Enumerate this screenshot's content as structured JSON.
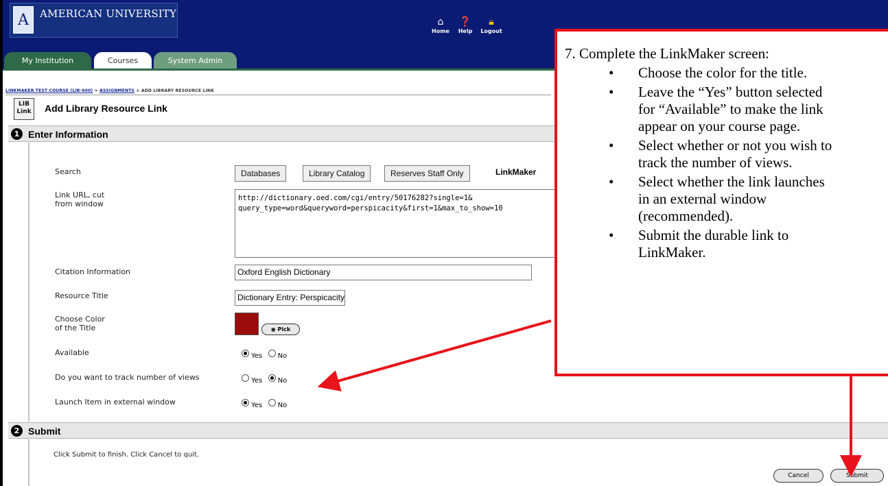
{
  "header": {
    "logo_text": "AMERICAN UNIVERSITY",
    "logo_mark": "A",
    "nav_icons": [
      {
        "label": "Home",
        "icon": "home-icon"
      },
      {
        "label": "Help",
        "icon": "help-icon"
      },
      {
        "label": "Logout",
        "icon": "lock-icon"
      }
    ]
  },
  "tabs": [
    {
      "label": "My Institution"
    },
    {
      "label": "Courses"
    },
    {
      "label": "System Admin"
    }
  ],
  "breadcrumb": {
    "course": "LINKMAKER TEST COURSE (LIB-600)",
    "sep1": " > ",
    "assignments": "ASSIGNMENTS",
    "sep2": " > ",
    "current": "ADD LIBRARY RESOURCE LINK"
  },
  "page": {
    "icon_text": "LIB Link",
    "title": "Add Library Resource Link"
  },
  "section1": {
    "number": "1",
    "title": "Enter Information"
  },
  "form": {
    "search_label": "Search",
    "search_buttons": [
      "Databases",
      "Library Catalog",
      "Reserves Staff Only"
    ],
    "linkmaker_label": "LinkMaker",
    "url_label": "Link URL, cut\nfrom window",
    "url_value": "http://dictionary.oed.com/cgi/entry/50176282?single=1&\nquery_type=word&queryword=perspicacity&first=1&max_to_show=10",
    "citation_label": "Citation Information",
    "citation_value": "Oxford English Dictionary",
    "title_label": "Resource Title",
    "title_value": "Dictionary Entry: Perspicacity",
    "color_label": "Choose Color\nof the Title",
    "color_value": "#9b0c0c",
    "pick_label": "Pick",
    "available_label": "Available",
    "track_label": "Do you want to track number of views",
    "launch_label": "Launch Item in external window",
    "yes": "Yes",
    "no": "No",
    "available": "yes",
    "track": "no",
    "launch": "yes"
  },
  "section2": {
    "number": "2",
    "title": "Submit"
  },
  "submit": {
    "instructions": "Click Submit to finish. Click Cancel to quit.",
    "cancel_label": "Cancel",
    "submit_label": "Submit"
  },
  "annotation": {
    "heading": "7. Complete the LinkMaker screen:",
    "bullets": [
      "Choose the color for the title.",
      "Leave the “Yes” button selected\nfor “Available” to make the link\nappear on your course page.",
      "Select whether or not you wish to\ntrack the number of views.",
      "Select whether the link launches\nin an external window\n(recommended).",
      "Submit the durable link to\nLinkMaker."
    ],
    "color": "#e8131b"
  }
}
